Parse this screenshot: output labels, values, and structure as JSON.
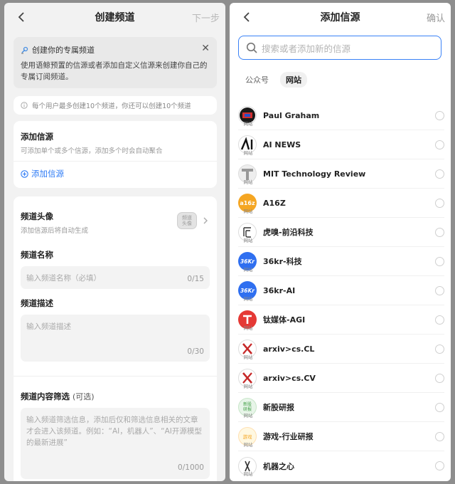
{
  "left": {
    "title": "创建频道",
    "next": "下一步",
    "notice": {
      "title": "创建你的专属频道",
      "body": "使用语鲸预置的信源或者添加自定义信源来创建你自己的专属订阅频道。"
    },
    "limit_note": "每个用户最多创建10个频道，你还可以创建10个频道",
    "source": {
      "title": "添加信源",
      "desc": "可添加单个或多个信源，添加多个时会自动聚合",
      "add_label": "添加信源"
    },
    "form": {
      "avatar_title": "频道头像",
      "avatar_desc": "添加信源后将自动生成",
      "avatar_placeholder": "频道\n头像",
      "name_label": "频道名称",
      "name_placeholder": "输入频道名称（必填）",
      "name_count": "0/15",
      "desc_label": "频道描述",
      "desc_placeholder": "输入频道描述",
      "desc_count": "0/30",
      "filter_label": "频道内容筛选",
      "filter_optional": "(可选)",
      "filter_placeholder": "输入频道筛选信息，添加后仅和筛选信息相关的文章才会进入该频道。例如：“AI，机器人”、“AI开源模型的最新进展”",
      "filter_count": "0/1000"
    }
  },
  "right": {
    "title": "添加信源",
    "confirm": "确认",
    "search_placeholder": "搜索或者添加新的信源",
    "tabs": [
      "公众号",
      "网站"
    ],
    "active_tab": "网站",
    "source_tag": "网站",
    "sources": [
      {
        "name": "Paul Graham",
        "icon": "paul-graham-logo"
      },
      {
        "name": "AI NEWS",
        "icon": "ai-news-logo"
      },
      {
        "name": "MIT Technology Review",
        "icon": "mit-tr-logo"
      },
      {
        "name": "A16Z",
        "icon": "a16z-logo"
      },
      {
        "name": "虎嗅-前沿科技",
        "icon": "huxiu-logo"
      },
      {
        "name": "36kr-科技",
        "icon": "36kr-logo"
      },
      {
        "name": "36kr-AI",
        "icon": "36kr-logo"
      },
      {
        "name": "钛媒体-AGI",
        "icon": "tmtpost-logo"
      },
      {
        "name": "arxiv>cs.CL",
        "icon": "arxiv-logo"
      },
      {
        "name": "arxiv>cs.CV",
        "icon": "arxiv-logo"
      },
      {
        "name": "新股研报",
        "icon": "ipo-report-logo"
      },
      {
        "name": "游戏-行业研报",
        "icon": "game-report-logo"
      },
      {
        "name": "机器之心",
        "icon": "jiqizhixin-logo"
      }
    ],
    "logo_text": {
      "a16z": "a16z",
      "kr": "36Kr",
      "ipo": "新股\n研报",
      "game": "游戏"
    }
  },
  "colors": {
    "accent": "#2f7cf6",
    "a16z": "#f5a623",
    "kr": "#2f6ff0",
    "tmt": "#e53935",
    "arxiv": "#c62828"
  }
}
